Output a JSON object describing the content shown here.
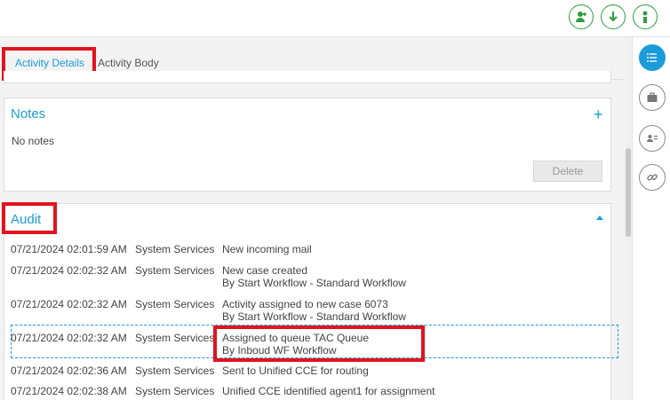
{
  "toolbar": {
    "buttons": [
      {
        "name": "add-user-icon"
      },
      {
        "name": "download-icon"
      },
      {
        "name": "person-touch-icon"
      }
    ],
    "accent": "#2e9c3f"
  },
  "tabs": [
    {
      "label": "Activity Details",
      "active": true
    },
    {
      "label": "Activity Body",
      "active": false
    }
  ],
  "notes": {
    "title": "Notes",
    "empty_text": "No notes",
    "delete_label": "Delete"
  },
  "audit": {
    "title": "Audit",
    "rows": [
      {
        "date": "07/21/2024 02:01:59 AM",
        "user": "System Services",
        "line1": "New incoming mail",
        "line2": ""
      },
      {
        "date": "07/21/2024 02:02:32 AM",
        "user": "System Services",
        "line1": "New case created",
        "line2": "By Start Workflow - Standard Workflow"
      },
      {
        "date": "07/21/2024 02:02:32 AM",
        "user": "System Services",
        "line1": "Activity assigned to new case 6073",
        "line2": "By Start Workflow - Standard Workflow"
      },
      {
        "date": "07/21/2024 02:02:32 AM",
        "user": "System Services",
        "line1": "Assigned to queue TAC Queue",
        "line2": "By Inboud WF Workflow"
      },
      {
        "date": "07/21/2024 02:02:36 AM",
        "user": "System Services",
        "line1": "Sent to Unified CCE for routing",
        "line2": ""
      },
      {
        "date": "07/21/2024 02:02:38 AM",
        "user": "System Services",
        "line1": "Unified CCE identified agent1 for assignment",
        "line2": ""
      }
    ]
  },
  "rightbar": {
    "buttons": [
      {
        "name": "list-icon",
        "active": true
      },
      {
        "name": "briefcase-icon",
        "active": false
      },
      {
        "name": "contact-card-icon",
        "active": false
      },
      {
        "name": "link-icon",
        "active": false
      }
    ]
  },
  "colors": {
    "accent": "#1a9cd8",
    "highlight": "#e0141e"
  }
}
